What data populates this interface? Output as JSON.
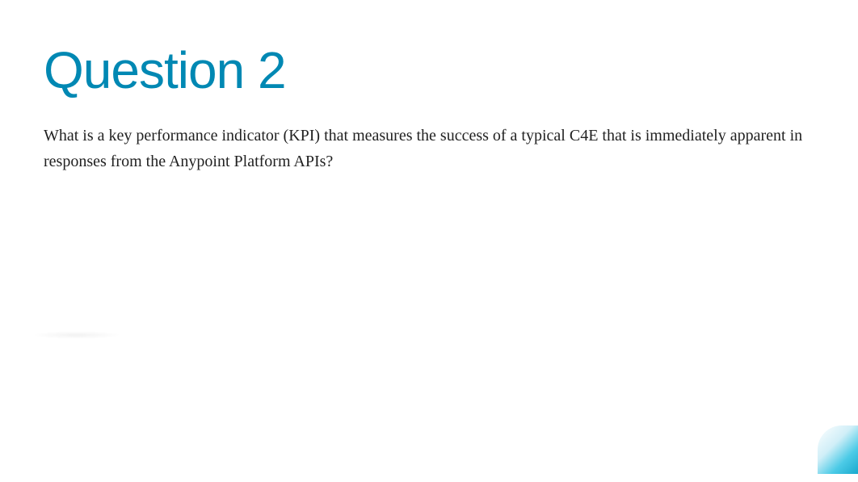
{
  "title": "Question 2",
  "body": " What is a key performance indicator (KPI) that measures the success of a typical C4E that is immediately apparent in responses from the Anypoint Platform APIs?"
}
